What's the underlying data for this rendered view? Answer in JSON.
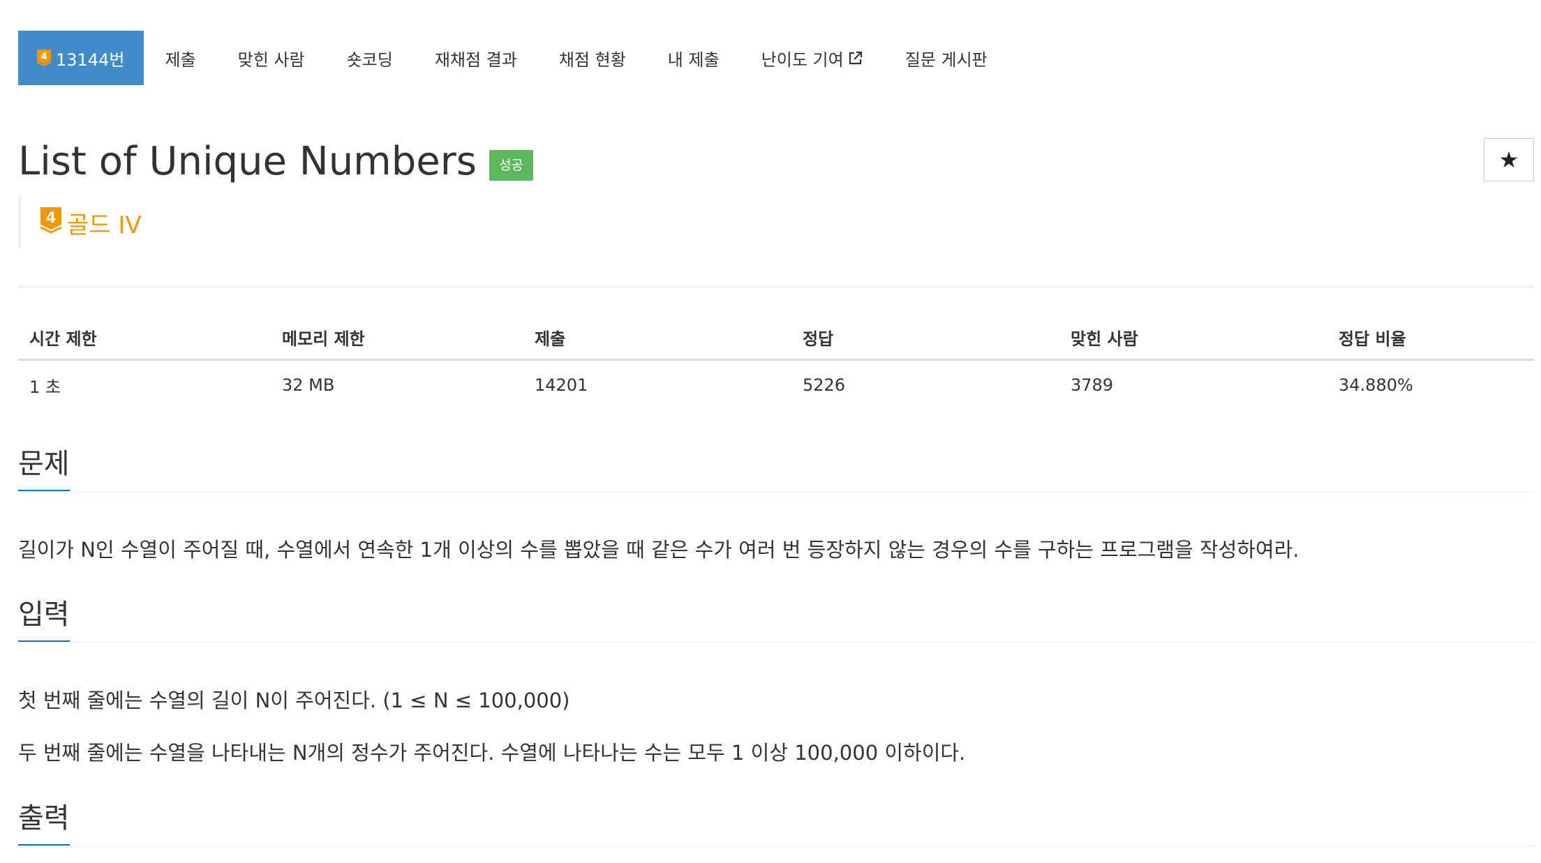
{
  "nav": {
    "problem_tab": {
      "tier_badge": "4",
      "label": "13144번"
    },
    "tabs": [
      {
        "label": "제출"
      },
      {
        "label": "맞힌 사람"
      },
      {
        "label": "숏코딩"
      },
      {
        "label": "재채점 결과"
      },
      {
        "label": "채점 현황"
      },
      {
        "label": "내 제출"
      },
      {
        "label": "난이도 기여",
        "icon": "external-link-icon"
      },
      {
        "label": "질문 게시판"
      }
    ]
  },
  "problem": {
    "title": "List of Unique Numbers",
    "status_badge": "성공",
    "tier_badge": "4",
    "tier_label": "골드 IV"
  },
  "stats": {
    "headers": [
      "시간 제한",
      "메모리 제한",
      "제출",
      "정답",
      "맞힌 사람",
      "정답 비율"
    ],
    "values": [
      "1 초",
      "32 MB",
      "14201",
      "5226",
      "3789",
      "34.880%"
    ]
  },
  "sections": {
    "problem": {
      "title": "문제",
      "text": "길이가 N인 수열이 주어질 때, 수열에서 연속한 1개 이상의 수를 뽑았을 때 같은 수가 여러 번 등장하지 않는 경우의 수를 구하는 프로그램을 작성하여라."
    },
    "input": {
      "title": "입력",
      "lines": [
        "첫 번째 줄에는 수열의 길이 N이 주어진다. (1 ≤ N ≤ 100,000)",
        "두 번째 줄에는 수열을 나타내는 N개의 정수가 주어진다. 수열에 나타나는 수는 모두 1 이상 100,000 이하이다."
      ]
    },
    "output": {
      "title": "출력"
    }
  },
  "colors": {
    "active_tab": "#428bca",
    "success": "#5cb85c",
    "gold_tier": "#ec9a00",
    "section_underline": "#0076c0"
  },
  "icons": {
    "star_button": "star-icon",
    "tier": "gold-tier-icon"
  }
}
